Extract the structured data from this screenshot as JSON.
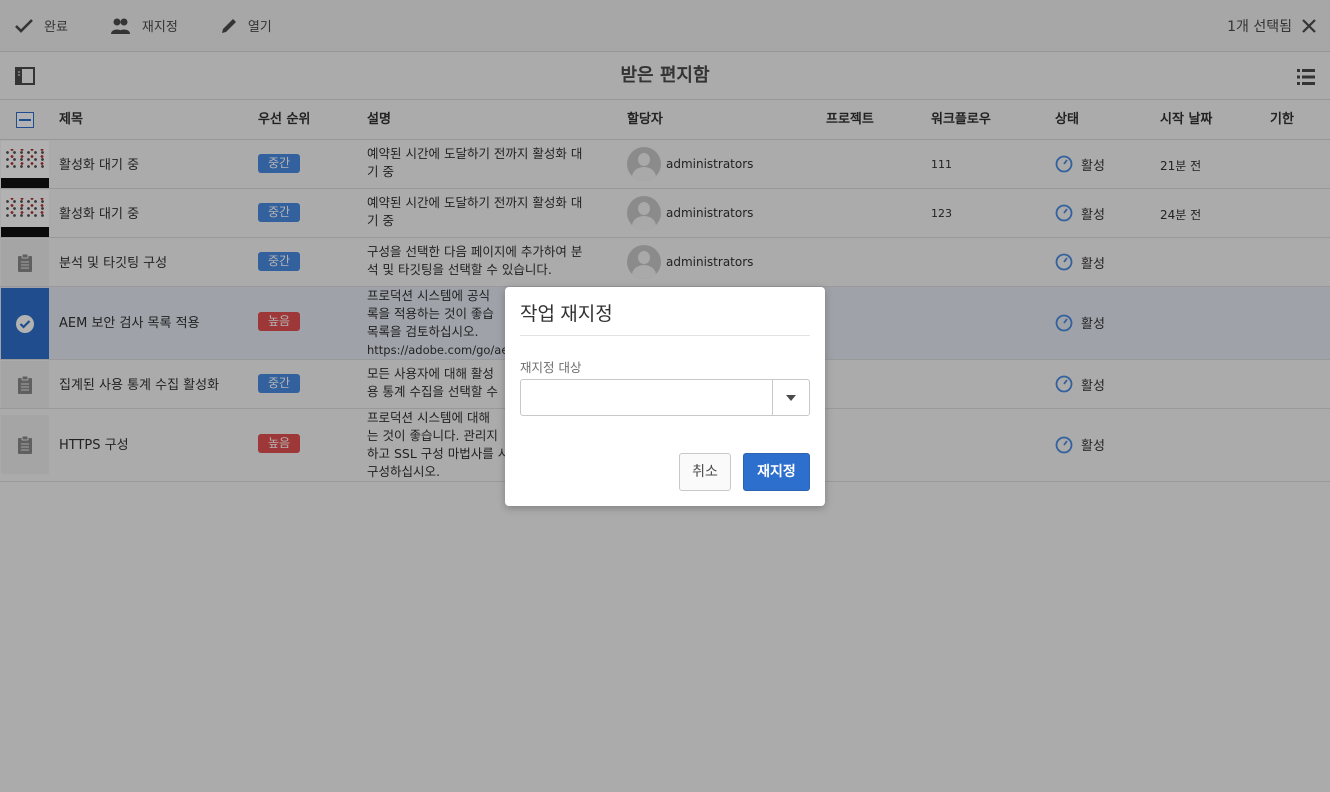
{
  "actionbar": {
    "complete_label": "완료",
    "reassign_label": "재지정",
    "open_label": "열기",
    "selection_count": "1개 선택됨"
  },
  "page": {
    "title": "받은 편지함"
  },
  "table": {
    "headers": {
      "title": "제목",
      "priority": "우선 순위",
      "description": "설명",
      "assignee": "할당자",
      "project": "프로젝트",
      "workflow": "워크플로우",
      "status": "상태",
      "start_date": "시작 날짜",
      "due": "기한"
    },
    "rows": [
      {
        "title": "활성화 대기 중",
        "priority": "중간",
        "desc": [
          "예약된 시간에 도달하기 전까지 활성화 대",
          "기 중"
        ],
        "assignee": "administrators",
        "workflow": "111",
        "status": "활성",
        "start": "21분 전"
      },
      {
        "title": "활성화 대기 중",
        "priority": "중간",
        "desc": [
          "예약된 시간에 도달하기 전까지 활성화 대",
          "기 중"
        ],
        "assignee": "administrators",
        "workflow": "123",
        "status": "활성",
        "start": "24분 전"
      },
      {
        "title": "분석 및 타깃팅 구성",
        "priority": "중간",
        "desc": [
          "구성을 선택한 다음 페이지에 추가하여 분",
          "석 및 타깃팅을 선택할 수 있습니다."
        ],
        "assignee": "administrators",
        "workflow": "",
        "status": "활성",
        "start": ""
      },
      {
        "title": "AEM 보안 검사 목록 적용",
        "priority": "높음",
        "desc": [
          "프로덕션 시스템에 공식",
          "록을 적용하는 것이 좋습",
          "목록을 검토하십시오.",
          "https://adobe.com/go/aem"
        ],
        "assignee": "",
        "workflow": "",
        "status": "활성",
        "start": ""
      },
      {
        "title": "집계된 사용 통계 수집 활성화",
        "priority": "중간",
        "desc": [
          "모든 사용자에 대해 활성",
          "용 통계 수집을 선택할 수"
        ],
        "assignee": "",
        "workflow": "",
        "status": "활성",
        "start": ""
      },
      {
        "title": "HTTPS 구성",
        "priority": "높음",
        "desc": [
          "프로덕션 시스템에 대해",
          "는 것이 좋습니다. 관리지",
          "하고 SSL 구성 마법사를 시",
          "구성하십시오."
        ],
        "assignee": "",
        "workflow": "",
        "status": "활성",
        "start": ""
      }
    ]
  },
  "dialog": {
    "title": "작업 재지정",
    "field_label": "재지정 대상",
    "field_value": "",
    "cancel_label": "취소",
    "confirm_label": "재지정"
  },
  "colors": {
    "accent": "#2d6fcc",
    "priority_medium": "#4a8be3",
    "priority_high": "#e34f4f",
    "status_icon": "#4a8be3"
  }
}
